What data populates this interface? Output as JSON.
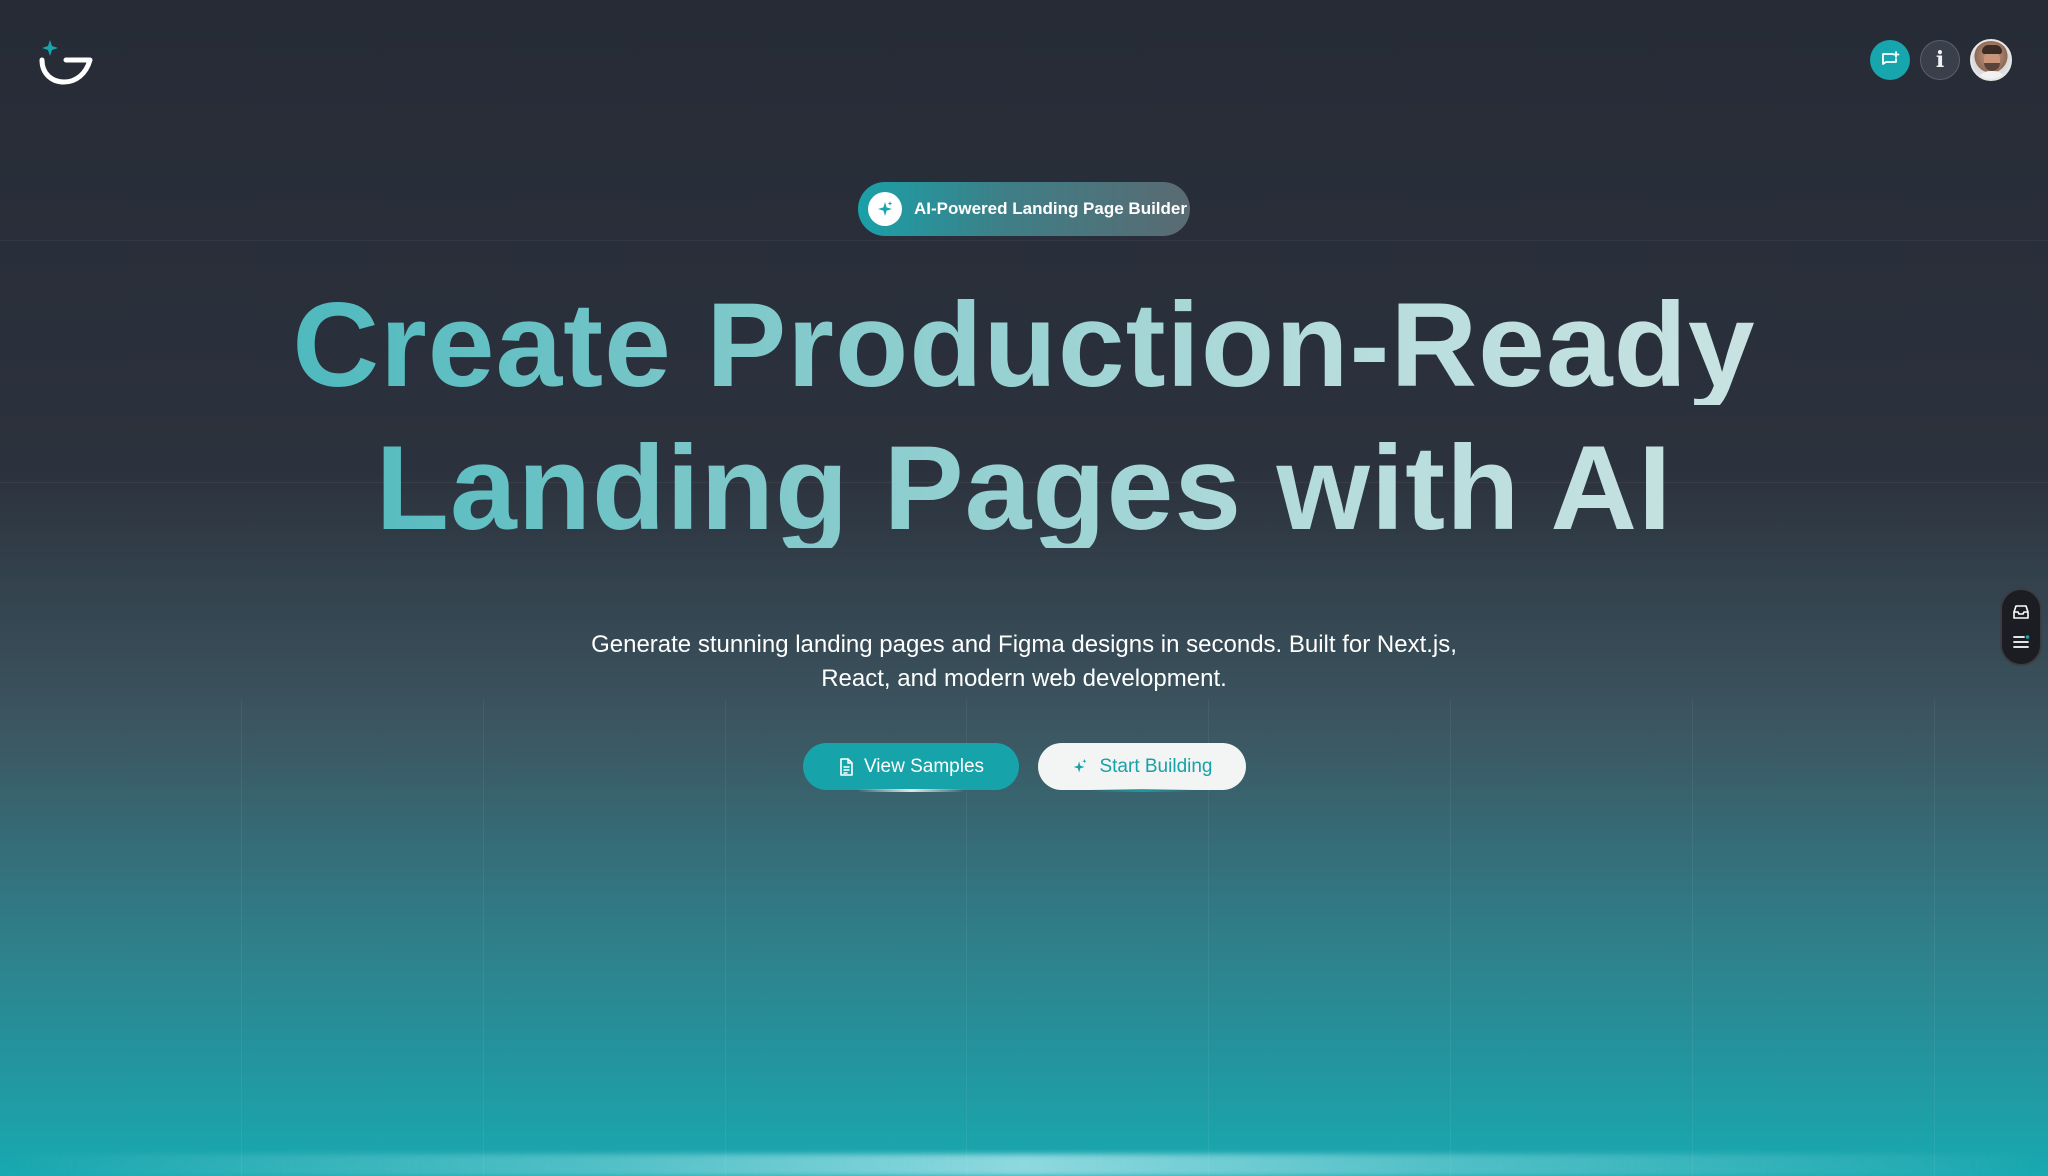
{
  "header": {
    "logo_icon": "sparkle-smile-logo",
    "actions": [
      {
        "name": "chat-add-icon",
        "type": "button"
      },
      {
        "name": "info-icon",
        "label": "i",
        "type": "button"
      },
      {
        "name": "avatar",
        "type": "profile"
      }
    ]
  },
  "hero": {
    "badge": {
      "icon": "sparkle-icon",
      "label": "AI-Powered Landing Page Builder"
    },
    "headline": {
      "line1": "Create Production-Ready",
      "line2": "Landing Pages with AI"
    },
    "subtitle": {
      "line1": "Generate stunning landing pages and Figma designs in seconds. Built for Next.js,",
      "line2": "React, and modern web development."
    },
    "buttons": {
      "primary": {
        "label": "View Samples",
        "icon": "document-icon"
      },
      "secondary": {
        "label": "Start Building",
        "icon": "sparkle-icon"
      }
    }
  },
  "side_widget": {
    "icons": [
      "inbox-icon",
      "menu-icon"
    ]
  },
  "colors": {
    "accent": "#17a6ad",
    "background_top": "#262b36",
    "background_bottom": "#18a9b1",
    "headline_start": "#2fb0b6",
    "headline_end": "#d5e7e6"
  }
}
